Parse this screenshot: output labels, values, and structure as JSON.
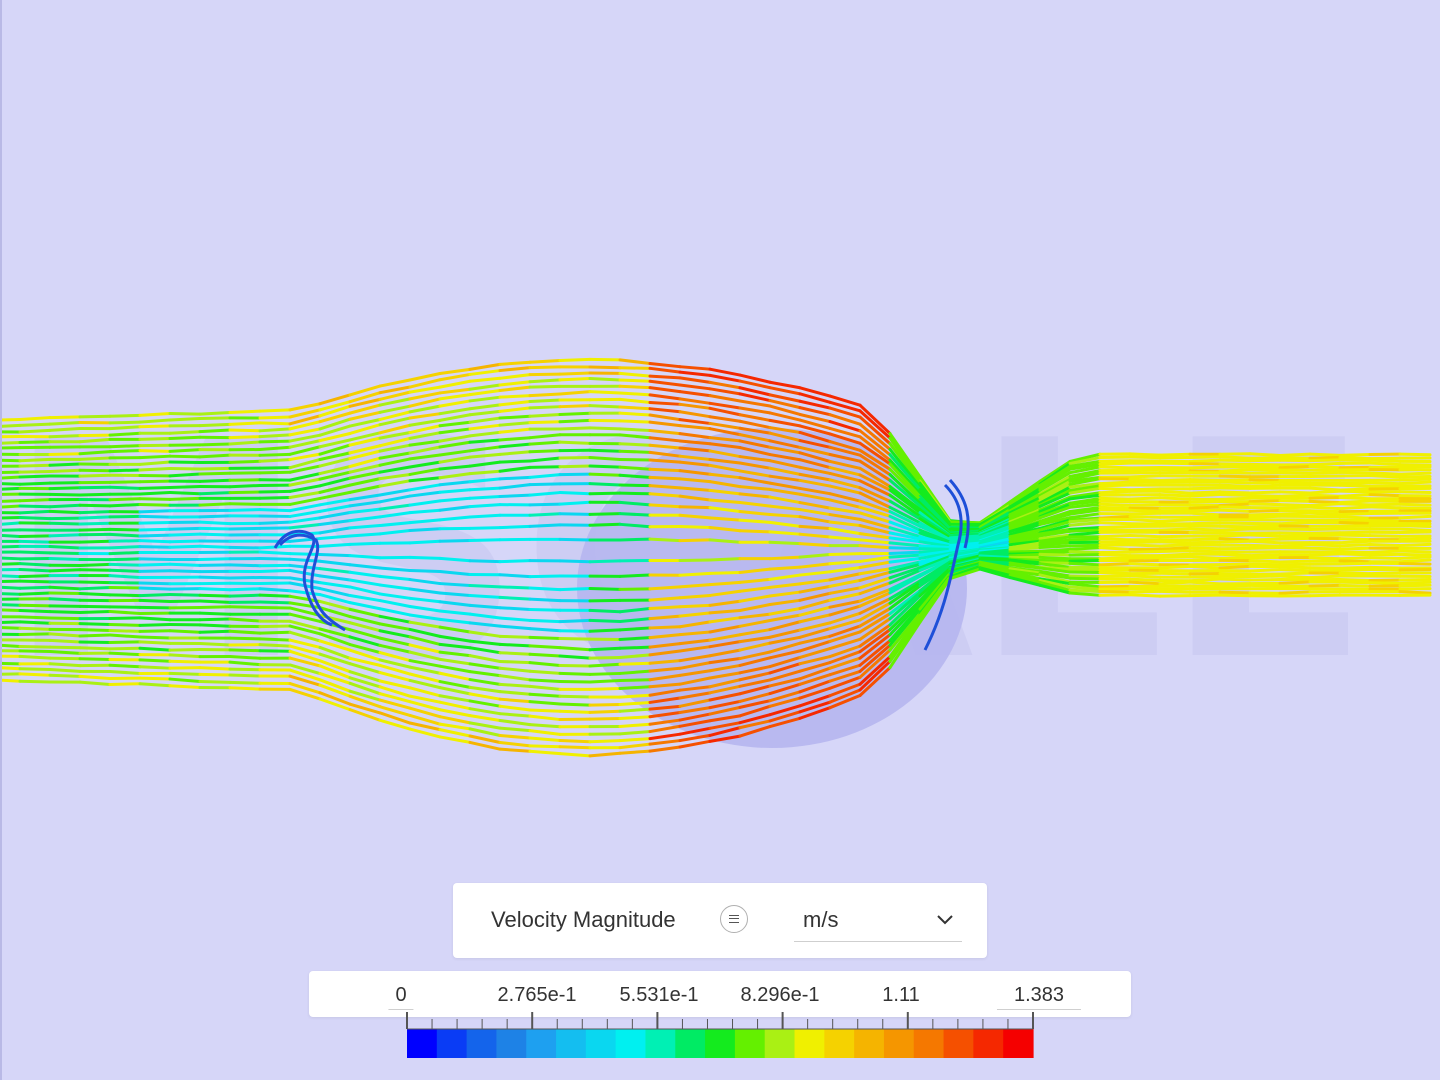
{
  "legend": {
    "field_name": "Velocity Magnitude",
    "menu_icon": "list-icon",
    "unit": "m/s",
    "unit_dropdown_icon": "chevron-down-icon"
  },
  "scale": {
    "tick_labels": [
      "0",
      "2.765e-1",
      "5.531e-1",
      "8.296e-1",
      "1.11",
      "1.383"
    ],
    "min": 0,
    "max": 1.383,
    "colors": [
      "#0000ff",
      "#0a3cf5",
      "#1464eb",
      "#1e82e6",
      "#1ea0f0",
      "#14bef0",
      "#0ad7f0",
      "#00f0f0",
      "#00f0b4",
      "#00eb64",
      "#14eb1e",
      "#64f000",
      "#aaf014",
      "#f0f000",
      "#f5d200",
      "#f5b400",
      "#f59600",
      "#f57800",
      "#f55000",
      "#f52800",
      "#f50000"
    ]
  },
  "watermark_text": "SIMSCALE"
}
